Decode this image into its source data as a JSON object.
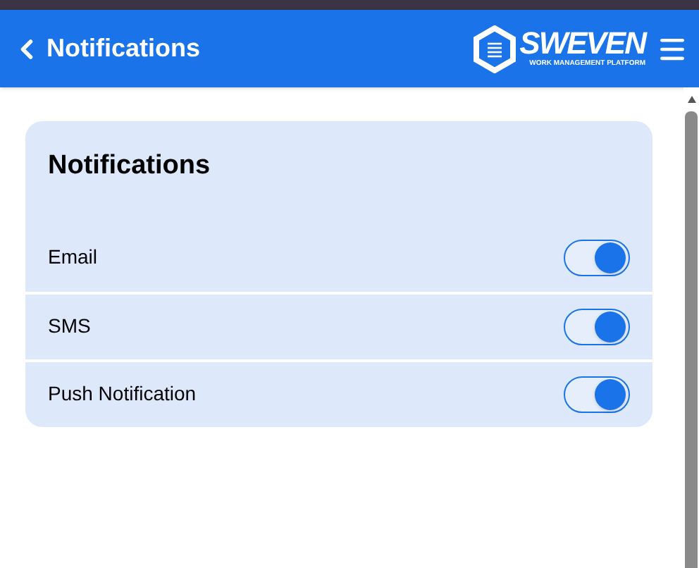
{
  "header": {
    "title": "Notifications",
    "logo": {
      "name": "SWEVEN",
      "tagline": "WORK MANAGEMENT PLATFORM"
    }
  },
  "card": {
    "title": "Notifications",
    "settings": [
      {
        "label": "Email",
        "on": true
      },
      {
        "label": "SMS",
        "on": true
      },
      {
        "label": "Push Notification",
        "on": true
      }
    ]
  }
}
